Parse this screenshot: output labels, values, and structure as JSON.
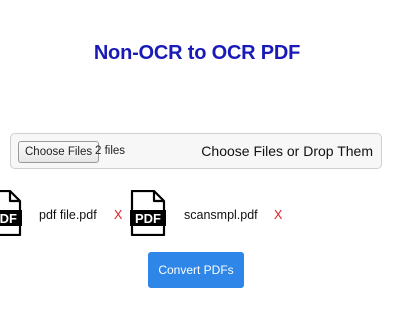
{
  "page_title": "Non-OCR to OCR PDF",
  "uploader": {
    "choose_button_label": "Choose Files",
    "file_count_text": "2 files",
    "drop_hint": "Choose Files or Drop Them"
  },
  "files": [
    {
      "icon_text": "PDF",
      "name": "pdf file.pdf",
      "remove_label": "X"
    },
    {
      "icon_text": "PDF",
      "name": "scansmpl.pdf",
      "remove_label": "X"
    }
  ],
  "convert_button_label": "Convert PDFs",
  "colors": {
    "title": "#1a1ab8",
    "remove": "#e02020",
    "primary_button": "#2d86e8"
  },
  "icons": [
    "pdf-file-icon"
  ]
}
